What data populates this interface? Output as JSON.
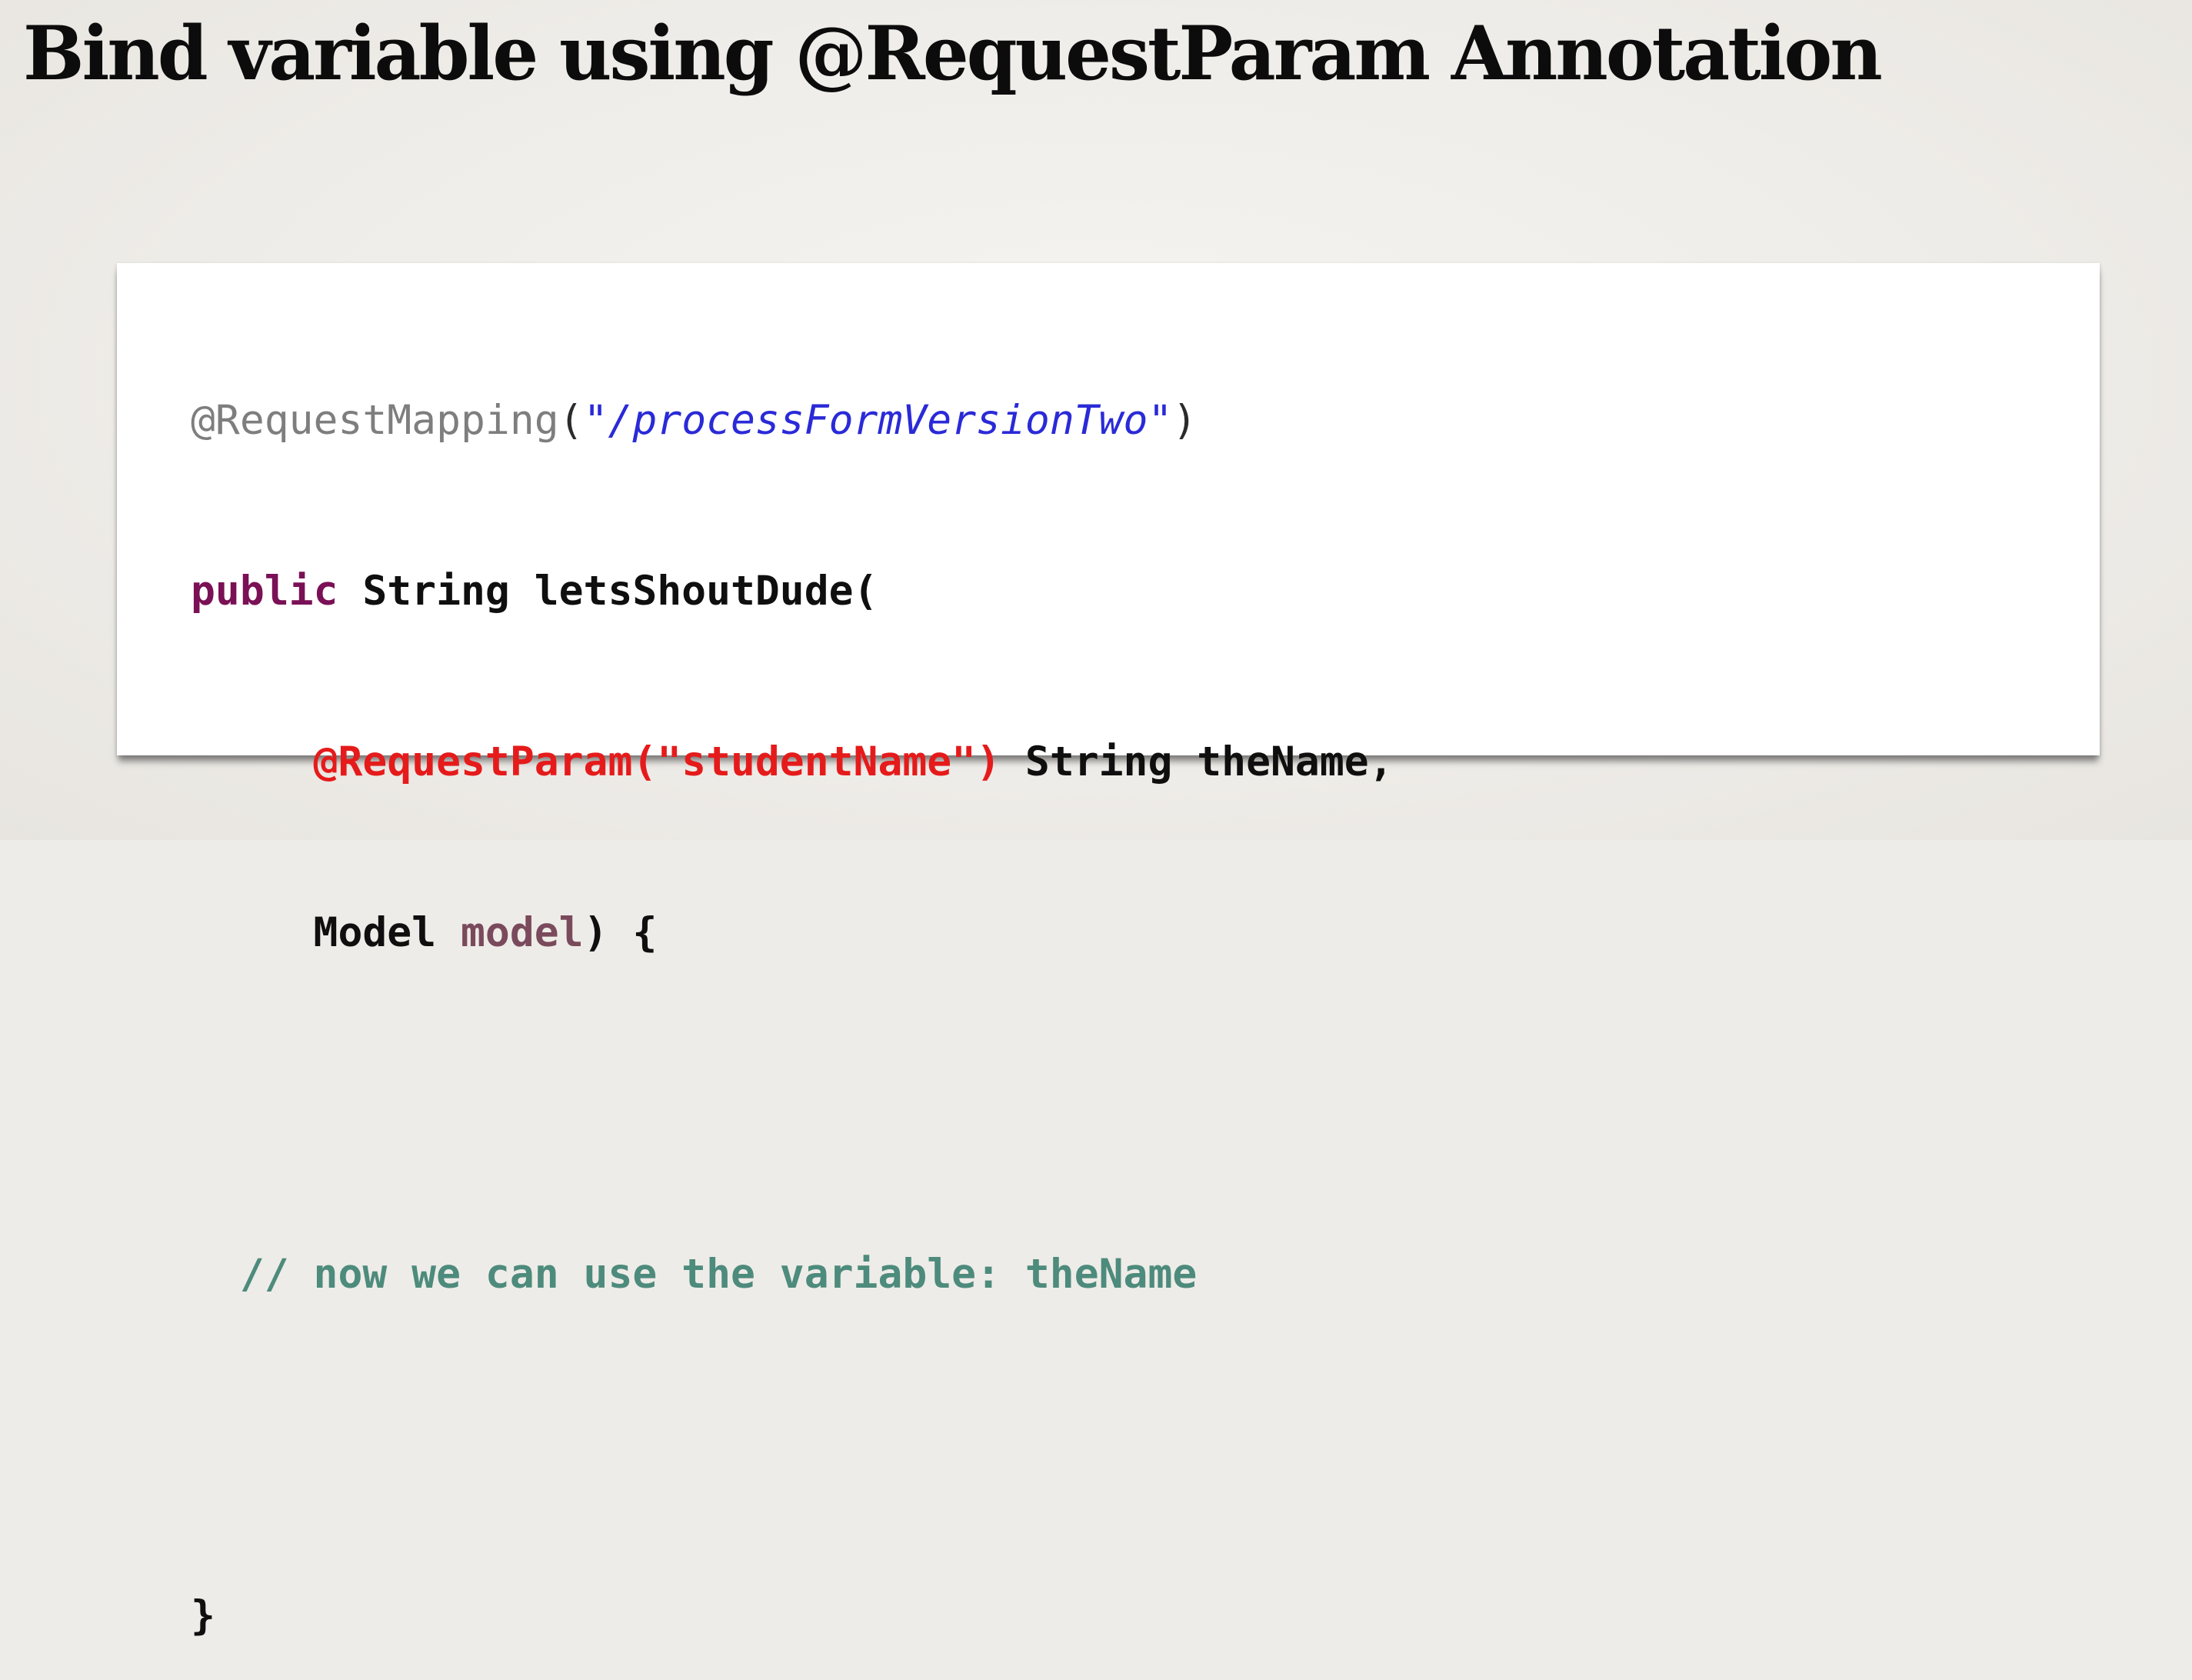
{
  "slide": {
    "title": "Bind variable using @RequestParam Annotation"
  },
  "code": {
    "line1": {
      "annotation": "@RequestMapping",
      "open_paren": "(",
      "path": "\"/processFormVersionTwo\"",
      "close_paren": ")"
    },
    "line2": {
      "keyword": "public",
      "signature": " String letsShoutDude("
    },
    "line3": {
      "indent": "     ",
      "request_param": "@RequestParam(\"studentName\")",
      "param_decl": " String theName,"
    },
    "line4": {
      "indent": "     ",
      "model_type": "Model ",
      "model_var": "model",
      "close": ") {"
    },
    "line5": "",
    "line6": {
      "comment": "  // now we can use the variable: theName"
    },
    "line7": "",
    "line8": {
      "closing_brace": "}"
    }
  },
  "colors": {
    "annotation": "#7e7e7e",
    "string": "#2a2ad8",
    "keyword": "#7a1055",
    "request_param": "#e51b1b",
    "variable": "#7a4a5c",
    "comment": "#4d8b7c",
    "text": "#0f0f0f"
  }
}
